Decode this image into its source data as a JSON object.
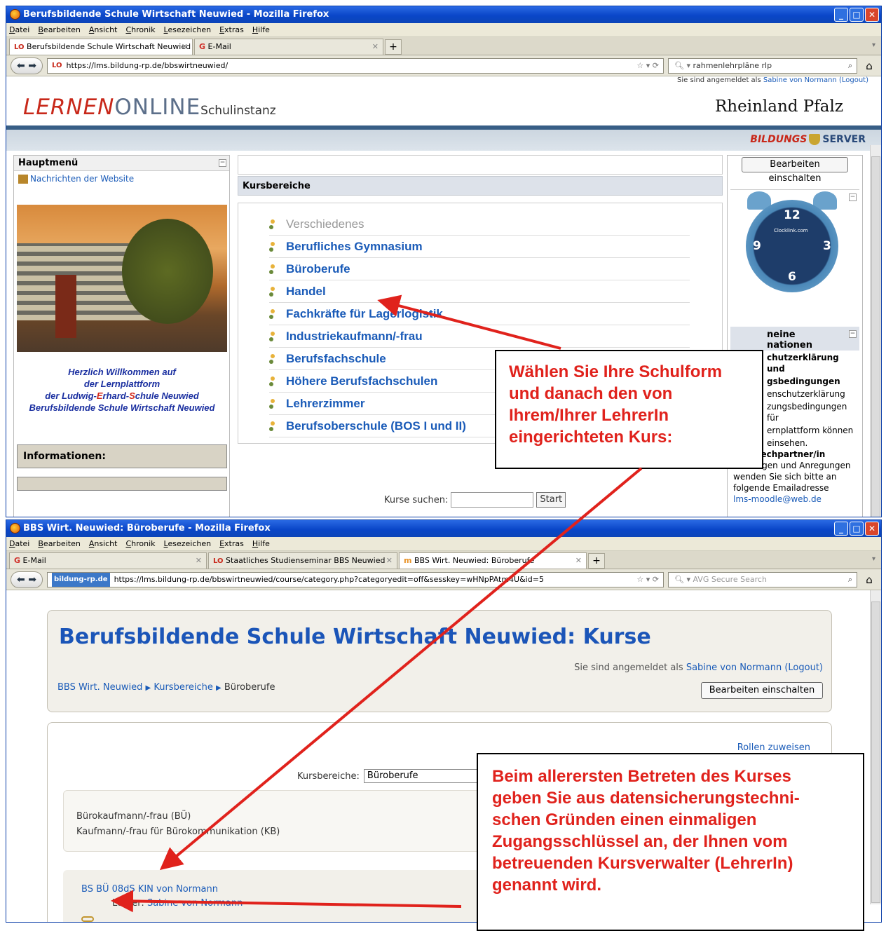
{
  "window1": {
    "title": "Berufsbildende Schule Wirtschaft Neuwied - Mozilla Firefox",
    "menu": [
      "Datei",
      "Bearbeiten",
      "Ansicht",
      "Chronik",
      "Lesezeichen",
      "Extras",
      "Hilfe"
    ],
    "tabs": [
      {
        "label": "Berufsbildende Schule Wirtschaft Neuwied",
        "icon": "lo-icon"
      },
      {
        "label": "E-Mail",
        "icon": "gmx-icon"
      }
    ],
    "url": "https://lms.bildung-rp.de/bbswirtneuwied/",
    "search_value": "rahmenlehrpläne rlp",
    "login_prefix": "Sie sind angemeldet als",
    "login_user": "Sabine von Normann",
    "logout": "(Logout)",
    "logo_red": "LERNEN",
    "logo_grey": "ONLINE",
    "logo_small": "Schulinstanz",
    "rlp_logo": "Rheinland Pfalz",
    "bildungs": "BILDUNGS",
    "server": "SERVER",
    "hauptmenu": "Hauptmenü",
    "news_link": "Nachrichten der Website",
    "welcome_l1": "Herzlich Willkommen auf",
    "welcome_l2": "der Lernplattform",
    "welcome_l3a": "der Ludwig-",
    "welcome_l3b": "E",
    "welcome_l3c": "rhard-",
    "welcome_l3d": "S",
    "welcome_l3e": "chule Neuwied",
    "welcome_l4": "Berufsbildende Schule Wirtschaft Neuwied",
    "informationen": "Informationen:",
    "kursbereiche_header": "Kursbereiche",
    "categories": [
      "Verschiedenes",
      "Berufliches Gymnasium",
      "Büroberufe",
      "Handel",
      "Fachkräfte für Lagerlogistik",
      "Industriekaufmann/-frau",
      "Berufsfachschule",
      "Höhere Berufsfachschulen",
      "Lehrerzimmer",
      "Berufsoberschule (BOS I und II)"
    ],
    "kurse_suchen": "Kurse suchen:",
    "start": "Start",
    "edit_button": "Bearbeiten einschalten",
    "clock_12": "12",
    "clock_3": "3",
    "clock_6": "6",
    "clock_9": "9",
    "clock_brand": "Clocklink.com",
    "info_head_a": "neine",
    "info_head_b": "nationen",
    "info_lines": [
      "chutzerklärung und",
      "gsbedingungen",
      "enschutzerklärung",
      "zungsbedingungen für",
      "ernplattform können",
      "einsehen."
    ],
    "ansprech": "Ansprechpartner/in",
    "ansprech_text": [
      "Bei Fragen und Anregungen",
      "wenden Sie sich bitte an",
      "folgende Emailadresse"
    ],
    "email_cut": "lms-moodle@web.de"
  },
  "window2": {
    "title": "BBS Wirt. Neuwied: Büroberufe - Mozilla Firefox",
    "menu": [
      "Datei",
      "Bearbeiten",
      "Ansicht",
      "Chronik",
      "Lesezeichen",
      "Extras",
      "Hilfe"
    ],
    "tabs": [
      {
        "label": "E-Mail",
        "icon": "gmx-icon"
      },
      {
        "label": "Staatliches Studienseminar BBS Neuwied",
        "icon": "lo-icon"
      },
      {
        "label": "BBS Wirt. Neuwied: Büroberufe",
        "icon": "moodle-icon"
      }
    ],
    "url_domain": "bildung-rp.de",
    "url": "https://lms.bildung-rp.de/bbswirtneuwied/course/category.php?categoryedit=off&sesskey=wHNpPAtm4U&id=5",
    "search_placeholder": "AVG Secure Search",
    "page_title": "Berufsbildende Schule Wirtschaft Neuwied: Kurse",
    "login_prefix": "Sie sind angemeldet als",
    "login_user": "Sabine von Normann",
    "logout": "(Logout)",
    "breadcrumb": [
      "BBS Wirt. Neuwied",
      "Kursbereiche",
      "Büroberufe"
    ],
    "edit_button": "Bearbeiten einschalten",
    "rollen": "Rollen zuweisen",
    "kursbereiche_label": "Kursbereiche:",
    "kursbereiche_value": "Büroberufe",
    "desc_lines": [
      "Bürokaufmann/-frau (BÜ)",
      "Kaufmann/-frau für Bürokommunikation (KB)"
    ],
    "course_name": "BS BÜ 08dS KIN von Normann",
    "teacher_label": "Lehrer:",
    "teacher_name": "Sabine von Normann",
    "cut_letter": "L"
  },
  "callout1": [
    "Wählen Sie Ihre Schulform",
    "und danach den von",
    "Ihrem/Ihrer LehrerIn",
    "eingerichteten Kurs:"
  ],
  "callout2": [
    "Beim allerersten Betreten des Kurses",
    "geben Sie aus datensicherungstechni-",
    "schen Gründen einen einmaligen",
    "Zugangsschlüssel an, der Ihnen vom",
    "betreuenden Kursverwalter (LehrerIn)",
    "genannt wird."
  ],
  "colors": {
    "accent_blue": "#1b55b8",
    "annotation_red": "#e0221c",
    "titlebar": "#0a46c8"
  }
}
